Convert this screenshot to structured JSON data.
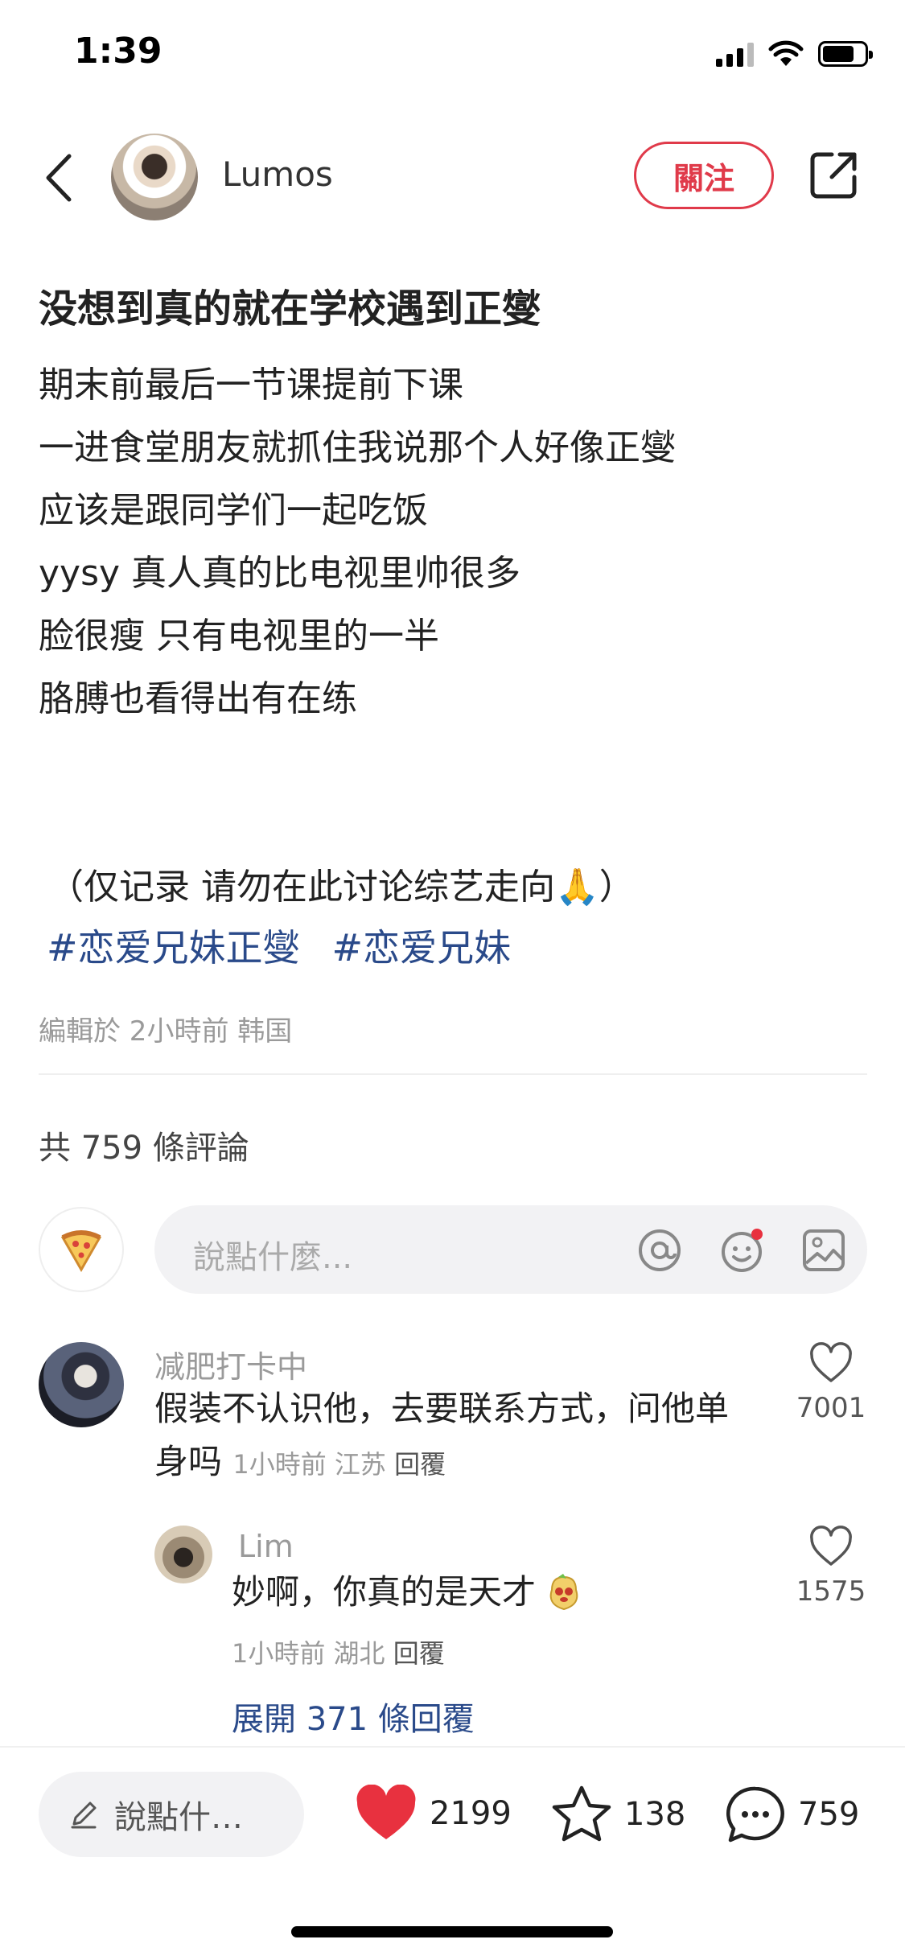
{
  "status": {
    "time": "1:39"
  },
  "header": {
    "author": "Lumos",
    "follow_label": "關注"
  },
  "post": {
    "title": "没想到真的就在学校遇到正燮",
    "lines": [
      "期末前最后一节课提前下课",
      "一进食堂朋友就抓住我说那个人好像正燮",
      "应该是跟同学们一起吃饭",
      "yysy 真人真的比电视里帅很多",
      "脸很瘦 只有电视里的一半",
      "胳膊也看得出有在练",
      "",
      "（仅记录 请勿在此讨论综艺走向🙏）"
    ],
    "hashtags": [
      "#恋爱兄妹正燮",
      "#恋爱兄妹"
    ],
    "meta": "編輯於 2小時前 韩国"
  },
  "comments_section": {
    "count_label": "共 759 條評論",
    "input_placeholder": "說點什麼...",
    "comments": [
      {
        "name": "减肥打卡中",
        "text_line1": "假装不认识他，去要联系方式，问他单",
        "text_line2": "身吗",
        "time": "1小時前",
        "location": "江苏",
        "reply_label": "回覆",
        "likes": "7001"
      },
      {
        "name": "Lim",
        "text": "妙啊，你真的是天才",
        "time": "1小時前",
        "location": "湖北",
        "reply_label": "回覆",
        "likes": "1575",
        "expand_label": "展開 371 條回覆"
      }
    ]
  },
  "bottom_bar": {
    "input_label": "說點什…",
    "likes": "2199",
    "favorites": "138",
    "comments": "759"
  },
  "colors": {
    "accent": "#e03a4a",
    "link": "#2a4a8a",
    "muted": "#9a9a9a"
  }
}
